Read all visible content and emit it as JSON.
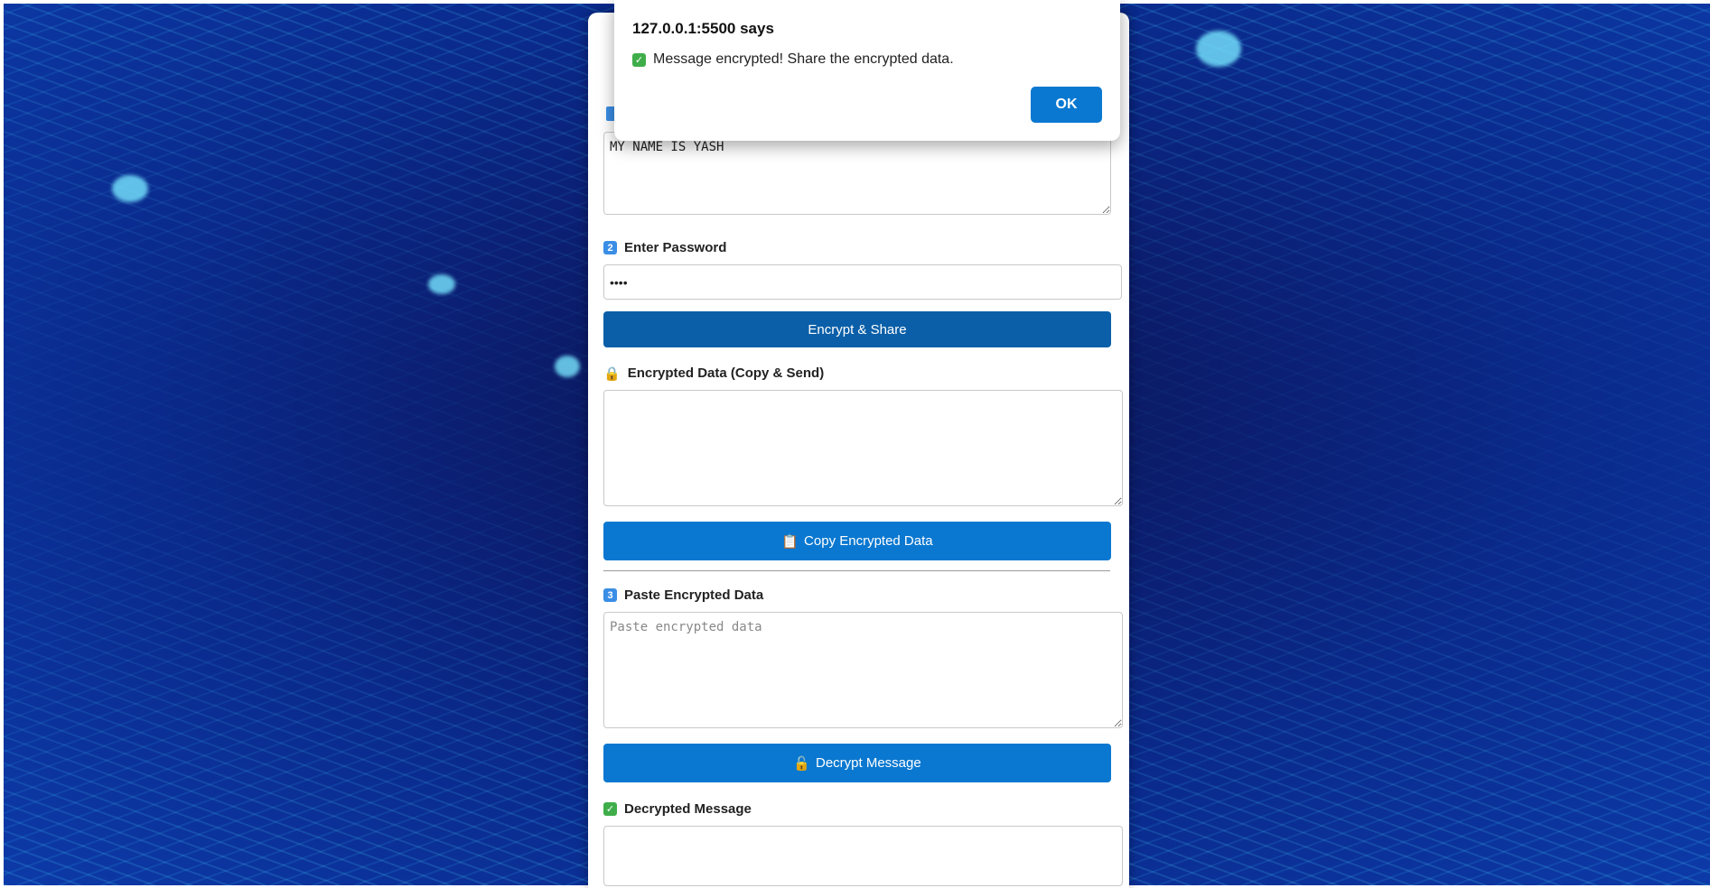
{
  "dialog": {
    "title": "127.0.0.1:5500 says",
    "message": "Message encrypted! Share the encrypted data.",
    "ok_label": "OK"
  },
  "message_field": {
    "value": "MY NAME IS YASH"
  },
  "password": {
    "number": "2",
    "label": "Enter Password",
    "value": "••••"
  },
  "encrypt_button": {
    "label": "Encrypt & Share"
  },
  "encrypted_data": {
    "label": "Encrypted Data (Copy & Send)",
    "value": ""
  },
  "copy_button": {
    "label": "Copy Encrypted Data"
  },
  "paste": {
    "number": "3",
    "label": "Paste Encrypted Data",
    "placeholder": "Paste encrypted data"
  },
  "decrypt_button": {
    "label": "Decrypt Message"
  },
  "decrypted": {
    "label": "Decrypted Message",
    "value": ""
  },
  "icons": {
    "check": "check-icon",
    "lock": "lock-icon",
    "clipboard": "clipboard-icon",
    "unlock": "unlock-icon"
  },
  "colors": {
    "primary_button": "#0a78d0",
    "encrypt_button": "#0a5fa8",
    "badge_blue": "#3a8ee6",
    "badge_green": "#3fae4a"
  }
}
